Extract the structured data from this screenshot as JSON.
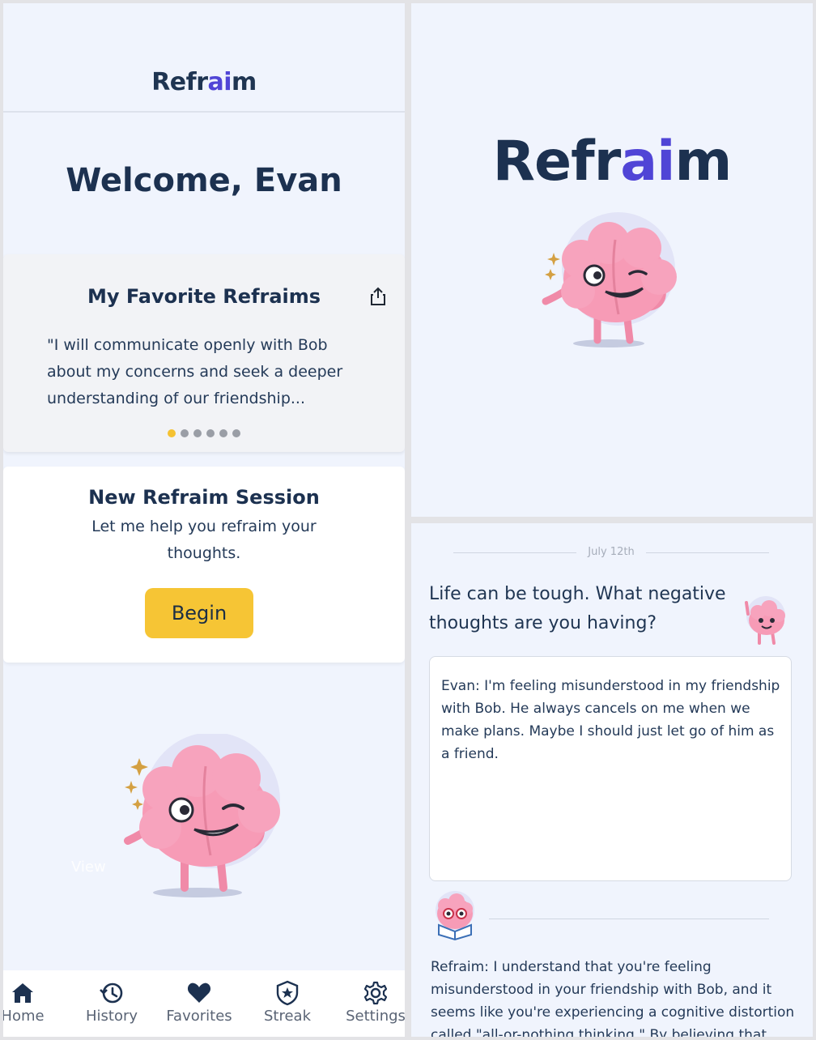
{
  "home": {
    "logo": {
      "part1": "Refr",
      "accent": "ai",
      "part2": "m"
    },
    "welcome": "Welcome, Evan",
    "favorites": {
      "title": "My Favorite Refraims",
      "quote": "\"I will communicate openly with Bob about my concerns and seek a deeper understanding of our friendship...",
      "page_count": 6,
      "active_page": 1
    },
    "session": {
      "title": "New Refraim Session",
      "subtitle": "Let me help you refraim your thoughts.",
      "button": "Begin"
    },
    "overlay_text": "View",
    "tabs": [
      {
        "label": "Home",
        "icon": "home-icon"
      },
      {
        "label": "History",
        "icon": "history-icon"
      },
      {
        "label": "Favorites",
        "icon": "heart-icon"
      },
      {
        "label": "Streak",
        "icon": "badge-star-icon"
      },
      {
        "label": "Settings",
        "icon": "gear-icon"
      }
    ]
  },
  "splash": {
    "logo": {
      "part1": "Refr",
      "accent": "ai",
      "part2": "m"
    }
  },
  "chat": {
    "date": "July 12th",
    "bot_prompt": "Life can be tough. What negative thoughts are you having?",
    "user_entry": "Evan: I'm feeling misunderstood in my friendship with Bob.  He always cancels on me when we make plans. Maybe I should just let go of him as a friend.",
    "reply": "Refraim: I understand that you're feeling misunderstood in your friendship with Bob, and it seems like you're experiencing a cognitive distortion called \"all-or-nothing thinking.\" By believing that"
  },
  "colors": {
    "background": "#f0f4fd",
    "brand_navy": "#1c3150",
    "brand_accent": "#5045d6",
    "button": "#f6c535",
    "dot_active": "#f5c232",
    "brain_pink": "#f79bb6"
  }
}
